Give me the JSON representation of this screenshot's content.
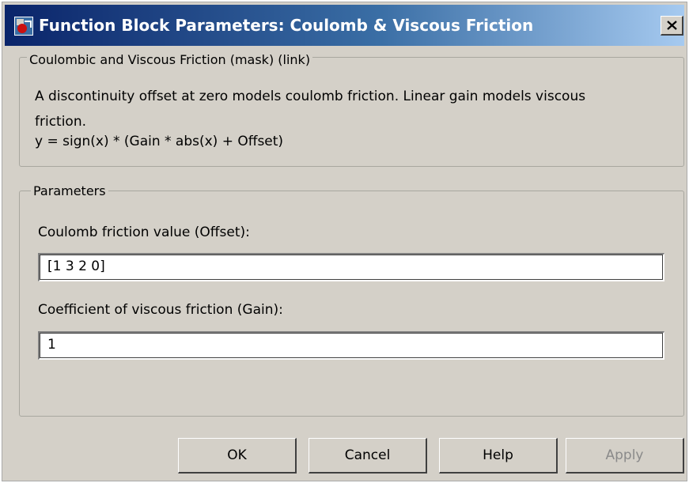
{
  "window": {
    "title": "Function Block Parameters: Coulomb & Viscous Friction",
    "close_label": "close"
  },
  "description_group": {
    "legend": "Coulombic and Viscous Friction (mask) (link)",
    "line1": "A discontinuity offset at zero models coulomb friction.  Linear gain models viscous",
    "line2": "friction.",
    "line3": "y = sign(x) * (Gain * abs(x) + Offset)"
  },
  "parameters_group": {
    "legend": "Parameters",
    "offset_label": "Coulomb friction value (Offset):",
    "offset_value": "[1 3 2 0]",
    "gain_label": "Coefficient of viscous friction (Gain):",
    "gain_value": "1"
  },
  "buttons": {
    "ok": "OK",
    "cancel": "Cancel",
    "help": "Help",
    "apply": "Apply"
  },
  "colors": {
    "titlebar_start": "#0a246a",
    "titlebar_end": "#a6caf0",
    "dialog_bg": "#d4d0c8",
    "disabled_text": "#8a8a8a"
  },
  "icons": {
    "app": "simulink-block-icon",
    "close": "close-icon"
  }
}
